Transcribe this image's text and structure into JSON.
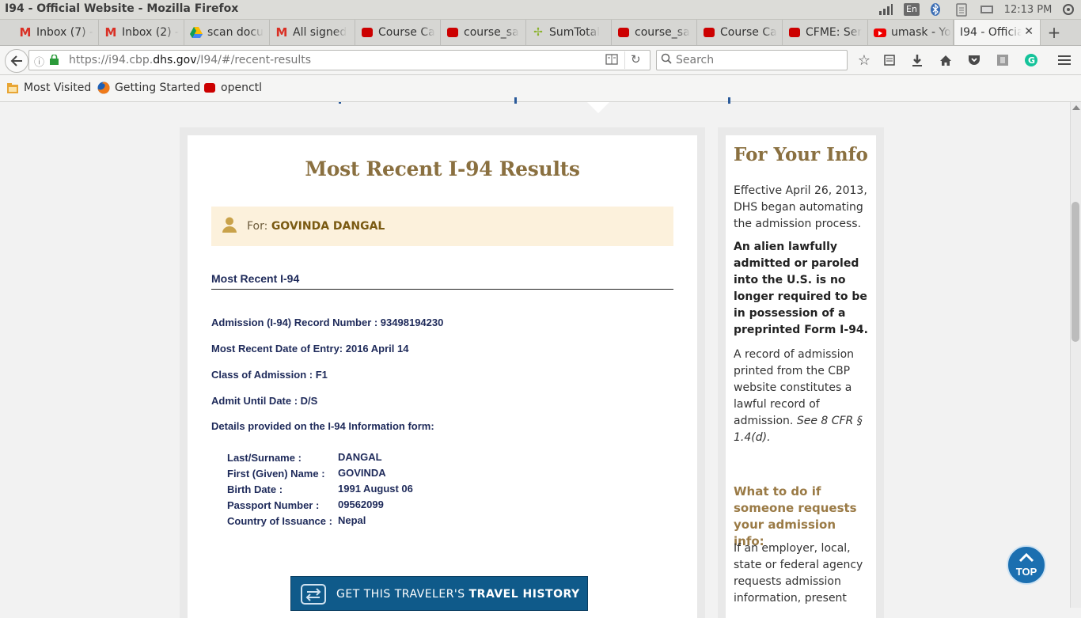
{
  "window": {
    "title": "I94 - Official Website - Mozilla Firefox"
  },
  "tray": {
    "lang": "En",
    "clock": "12:13 PM"
  },
  "tabs": [
    {
      "label": "Inbox (7) -",
      "icon": "gmail-icon"
    },
    {
      "label": "Inbox (2) -",
      "icon": "gmail-icon"
    },
    {
      "label": "scan docu",
      "icon": "google-drive-icon"
    },
    {
      "label": "All signed",
      "icon": "gmail-icon"
    },
    {
      "label": "Course Ca",
      "icon": "redhat-icon"
    },
    {
      "label": "course_sa",
      "icon": "redhat-icon"
    },
    {
      "label": "SumTotal",
      "icon": "sumtotal-icon"
    },
    {
      "label": "course_sa",
      "icon": "redhat-icon"
    },
    {
      "label": "Course Ca",
      "icon": "redhat-icon"
    },
    {
      "label": "CFME: Ser",
      "icon": "redhat-icon"
    },
    {
      "label": "umask - Yo",
      "icon": "youtube-icon"
    },
    {
      "label": "I94 - Officia",
      "icon": "none",
      "active": true
    }
  ],
  "nav": {
    "url_prefix": "https://i94.cbp.",
    "url_domain": "dhs.gov",
    "url_path": "/I94/#/recent-results",
    "search_placeholder": "Search"
  },
  "bookmarks": [
    {
      "label": "Most Visited",
      "icon": "folder-icon"
    },
    {
      "label": "Getting Started",
      "icon": "firefox-icon"
    },
    {
      "label": "openctl",
      "icon": "redhat-icon"
    }
  ],
  "main": {
    "title": "Most Recent I-94 Results",
    "for_label": "For:",
    "for_name": "GOVINDA DANGAL",
    "section_heading": "Most Recent I-94",
    "record_number": "Admission (I-94) Record Number : 93498194230",
    "entry_date": "Most Recent Date of Entry: 2016 April 14",
    "class_of_admission": "Class of Admission : F1",
    "admit_until": "Admit Until Date : D/S",
    "details_heading": "Details provided on the I-94 Information form:",
    "details": [
      {
        "label": "Last/Surname :",
        "value": "DANGAL"
      },
      {
        "label": "First (Given) Name :",
        "value": "GOVINDA"
      },
      {
        "label": "Birth Date :",
        "value": "1991 August 06"
      },
      {
        "label": "Passport Number :",
        "value": "09562099"
      },
      {
        "label": "Country of Issuance :",
        "value": "Nepal"
      }
    ],
    "history_button_prefix": "GET THIS TRAVELER'S ",
    "history_button_bold": "TRAVEL HISTORY"
  },
  "sidebar": {
    "title": "For Your Info",
    "p1": "Effective April 26, 2013, DHS began automating the admission process.",
    "p2": "An alien lawfully admitted or paroled into the U.S. is no longer required to be in possession of a preprinted Form I-94.",
    "p3_text": "A record of admission printed from the CBP website constitutes a lawful record of admission.",
    "p3_cite": "See 8 CFR § 1.4(d).",
    "what_to_do": "What to do if someone requests your admission info:",
    "p4": "If an employer, local, state or federal agency requests admission information, present"
  },
  "top_button": {
    "label": "TOP"
  },
  "colors": {
    "accent_gold": "#8a7040",
    "navy_text": "#1e2a5a",
    "button_blue": "#0f5a8a",
    "for_box_bg": "#fcf1dc"
  }
}
